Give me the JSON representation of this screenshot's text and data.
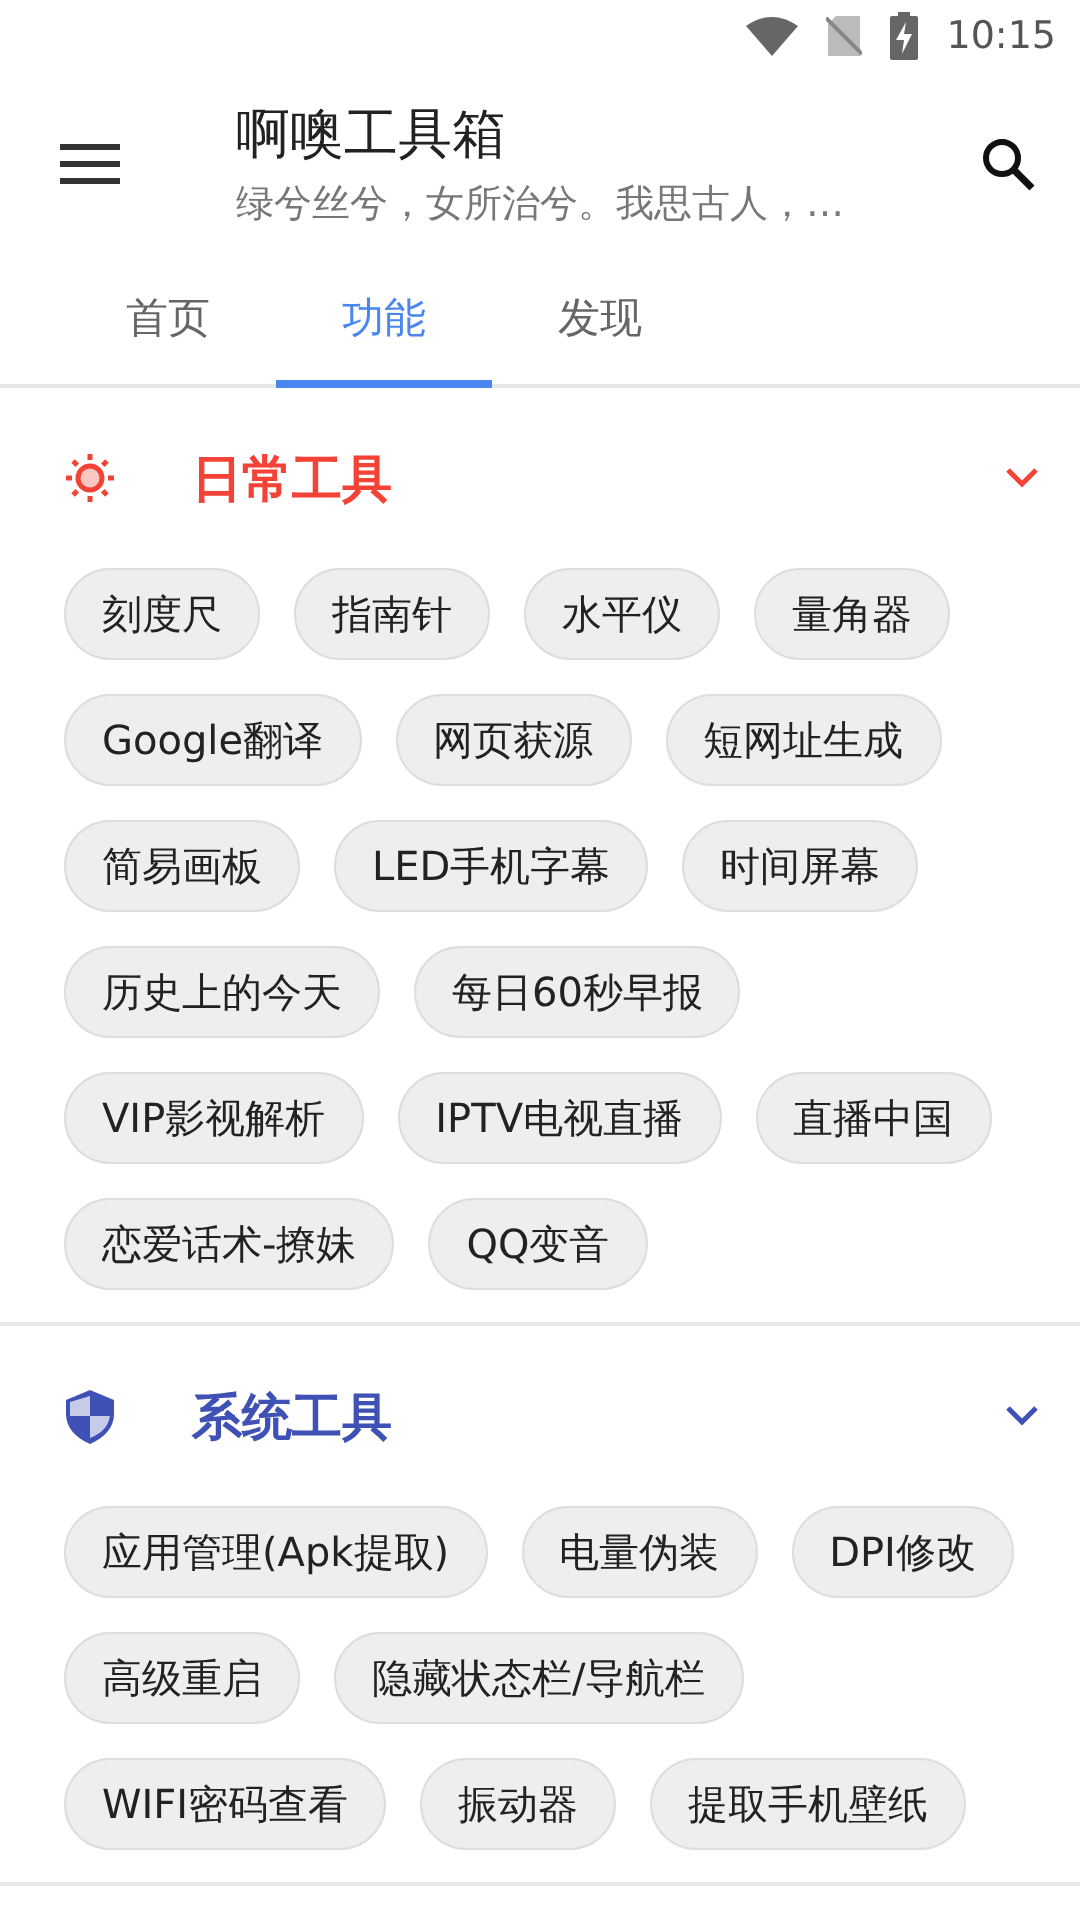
{
  "status_bar": {
    "time": "10:15"
  },
  "app_bar": {
    "title": "啊噢工具箱",
    "subtitle": "绿兮丝兮，女所治兮。我思古人，…"
  },
  "tabs": [
    {
      "label": "首页",
      "selected": false
    },
    {
      "label": "功能",
      "selected": true
    },
    {
      "label": "发现",
      "selected": false
    }
  ],
  "sections": [
    {
      "title": "日常工具",
      "kind": "daily",
      "color": "#f44336",
      "tools": [
        "刻度尺",
        "指南针",
        "水平仪",
        "量角器",
        "Google翻译",
        "网页获源",
        "短网址生成",
        "简易画板",
        "LED手机字幕",
        "时间屏幕",
        "历史上的今天",
        "每日60秒早报",
        "VIP影视解析",
        "IPTV电视直播",
        "直播中国",
        "恋爱话术-撩妹",
        "QQ变音"
      ]
    },
    {
      "title": "系统工具",
      "kind": "system",
      "color": "#3f51b5",
      "tools": [
        "应用管理(Apk提取)",
        "电量伪装",
        "DPI修改",
        "高级重启",
        "隐藏状态栏/导航栏",
        "WIFI密码查看",
        "振动器",
        "提取手机壁纸"
      ]
    }
  ]
}
